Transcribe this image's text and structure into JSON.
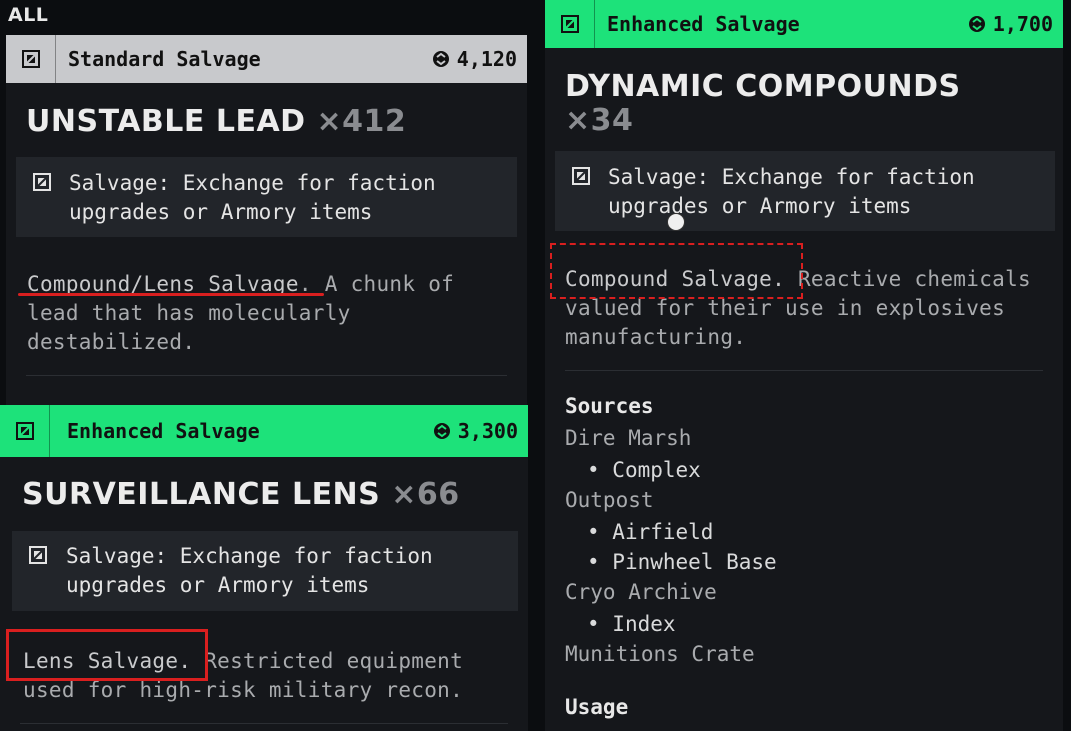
{
  "filter_label": "ALL",
  "colors": {
    "enhanced": "#1de27a",
    "standard": "#c8c9cc",
    "annotation_red": "#d91f1f"
  },
  "cards": [
    {
      "tier": "Standard Salvage",
      "price": "4,120",
      "name": "UNSTABLE LEAD",
      "count": "×412",
      "info": "Salvage: Exchange for faction upgrades or Armory items",
      "desc_type": "Compound/Lens Salvage",
      "desc_rest": ". A chunk of lead that has molecularly destabilized."
    },
    {
      "tier": "Enhanced Salvage",
      "price": "3,300",
      "name": "SURVEILLANCE LENS",
      "count": "×66",
      "info": "Salvage: Exchange for faction upgrades or Armory items",
      "desc_type": "Lens Salvage.",
      "desc_rest": " Restricted equipment used for high-risk military recon."
    },
    {
      "tier": "Enhanced Salvage",
      "price": "1,700",
      "name": "DYNAMIC COMPOUNDS",
      "count": "×34",
      "info": "Salvage: Exchange for faction upgrades or Armory items",
      "desc_type": "Compound Salvage.",
      "desc_rest": " Reactive chemicals valued for their use in explosives manufacturing.",
      "sources_heading": "Sources",
      "sources": [
        "Dire Marsh",
        "Complex",
        "Outpost",
        "Airfield",
        "Pinwheel Base",
        "Cryo Archive",
        "Index",
        "Munitions Crate"
      ],
      "usage_heading": "Usage"
    }
  ]
}
